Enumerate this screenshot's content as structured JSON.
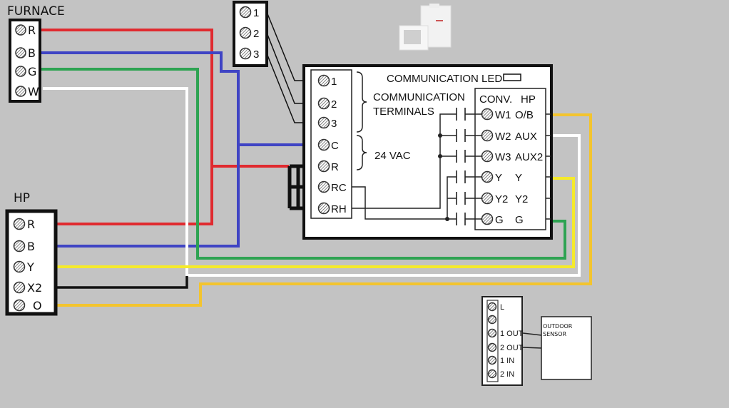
{
  "furnace": {
    "title": "FURNACE",
    "terminals": [
      "R",
      "B",
      "G",
      "W"
    ]
  },
  "heat_pump": {
    "title": "HP",
    "terminals": [
      "R",
      "B",
      "Y",
      "X2",
      "O"
    ]
  },
  "comm_block": {
    "terminals": [
      "1",
      "2",
      "3"
    ]
  },
  "control_board": {
    "led_label": "COMMUNICATION LED",
    "left_terminals": [
      "1",
      "2",
      "3",
      "C",
      "R",
      "RC",
      "RH"
    ],
    "comm_label_line1": "COMMUNICATION",
    "comm_label_line2": "TERMINALS",
    "vac_label": "24 VAC",
    "right_header_conv": "CONV.",
    "right_header_hp": "HP",
    "right_terminals": [
      {
        "conv": "W1",
        "hp": "O/B"
      },
      {
        "conv": "W2",
        "hp": "AUX"
      },
      {
        "conv": "W3",
        "hp": "AUX2"
      },
      {
        "conv": "Y",
        "hp": "Y"
      },
      {
        "conv": "Y2",
        "hp": "Y2"
      },
      {
        "conv": "G",
        "hp": "G"
      }
    ]
  },
  "sensor_block": {
    "terminals": [
      "L",
      "",
      "1 OUT",
      "2 OUT",
      "1 IN",
      "2 IN"
    ],
    "sensor_line1": "OUTDOOR",
    "sensor_line2": "SENSOR"
  },
  "wire_colors": {
    "red": "#e02a2f",
    "blue": "#3f44c4",
    "green": "#2ea352",
    "white": "#ffffff",
    "yellow": "#f5ea2a",
    "orange": "#f3c42e",
    "black": "#111111"
  }
}
